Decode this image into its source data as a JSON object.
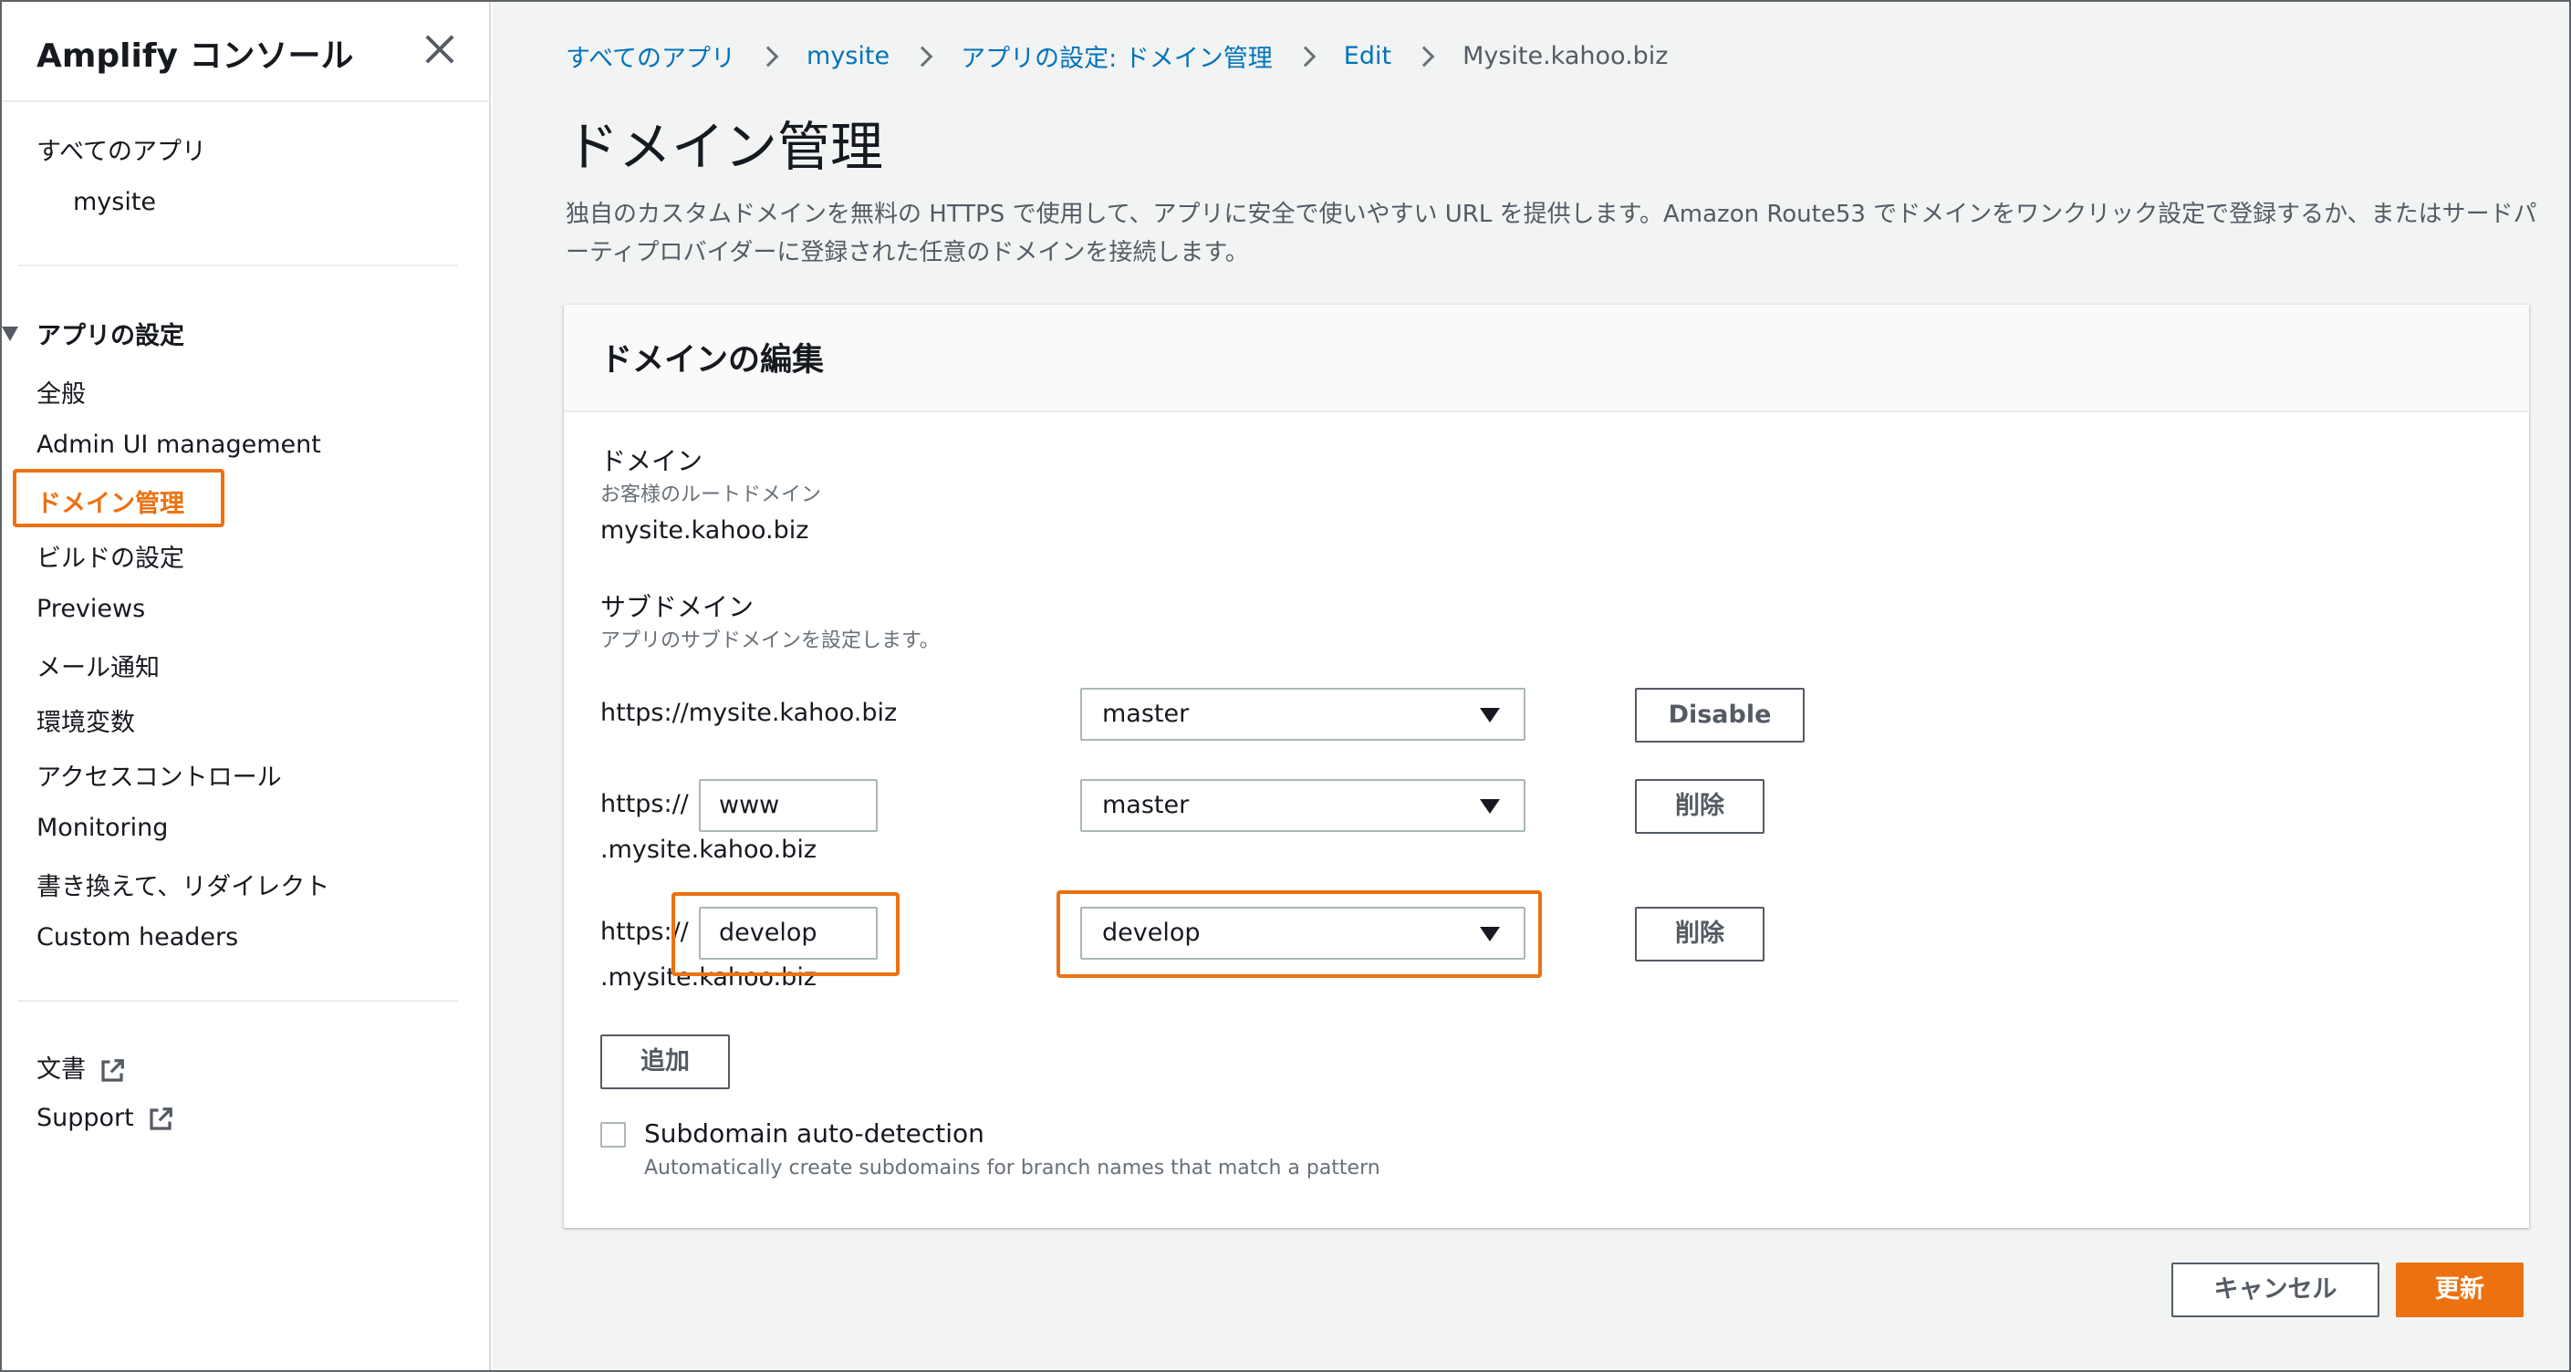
{
  "sidebar": {
    "title": "Amplify コンソール",
    "all_apps": "すべてのアプリ",
    "app_name": "mysite",
    "section_title": "アプリの設定",
    "items": [
      {
        "label": "全般"
      },
      {
        "label": "Admin UI management"
      },
      {
        "label": "ドメイン管理"
      },
      {
        "label": "ビルドの設定"
      },
      {
        "label": "Previews"
      },
      {
        "label": "メール通知"
      },
      {
        "label": "環境変数"
      },
      {
        "label": "アクセスコントロール"
      },
      {
        "label": "Monitoring"
      },
      {
        "label": "書き換えて、リダイレクト"
      },
      {
        "label": "Custom headers"
      }
    ],
    "docs": "文書",
    "support": "Support"
  },
  "breadcrumb": [
    "すべてのアプリ",
    "mysite",
    "アプリの設定: ドメイン管理",
    "Edit",
    "Mysite.kahoo.biz"
  ],
  "page": {
    "title": "ドメイン管理",
    "description": "独自のカスタムドメインを無料の HTTPS で使用して、アプリに安全で使いやすい URL を提供します。Amazon Route53 でドメインをワンクリック設定で登録するか、またはサードパーティプロバイダーに登録された任意のドメインを接続します。"
  },
  "card": {
    "title": "ドメインの編集",
    "domain_label": "ドメイン",
    "domain_sub": "お客様のルートドメイン",
    "domain_value": "mysite.kahoo.biz",
    "subdomain_label": "サブドメイン",
    "subdomain_sub": "アプリのサブドメインを設定します。",
    "rows": [
      {
        "url": "https://mysite.kahoo.biz",
        "branch": "master",
        "button": "Disable"
      },
      {
        "prefix": "https://",
        "subdomain": "www",
        "suffix": ".mysite.kahoo.biz",
        "branch": "master",
        "button": "削除"
      },
      {
        "prefix": "https://",
        "subdomain": "develop",
        "suffix": ".mysite.kahoo.biz",
        "branch": "develop",
        "button": "削除"
      }
    ],
    "add_button": "追加",
    "auto_detect_label": "Subdomain auto-detection",
    "auto_detect_sub": "Automatically create subdomains for branch names that match a pattern"
  },
  "footer": {
    "cancel": "キャンセル",
    "update": "更新"
  },
  "colors": {
    "accent": "#ec7211",
    "link": "#0073bb"
  }
}
